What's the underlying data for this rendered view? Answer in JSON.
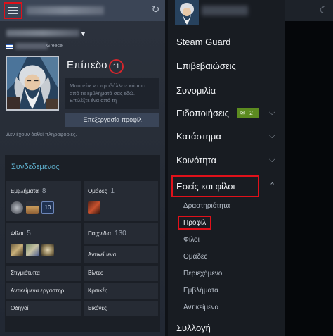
{
  "left": {
    "header": {
      "hamburger_icon": "hamburger-icon",
      "refresh_icon": "refresh-icon"
    },
    "profile": {
      "country": "Greece",
      "level_label": "Επίπεδο",
      "level": "11",
      "showcase_text": "Μπορείτε να προβάλλετε κάποιο από τα εμβλήματά σας εδώ. Επιλέξτε ένα από τη",
      "edit_button": "Επεξεργασία προφίλ",
      "no_info": "Δεν έχουν δοθεί πληροφορίες."
    },
    "status": "Συνδεδεμένος",
    "stats": {
      "badges": {
        "label": "Εμβλήματα",
        "count": "8"
      },
      "groups": {
        "label": "Ομάδες",
        "count": "1"
      },
      "friends": {
        "label": "Φίλοι",
        "count": "5"
      },
      "games": {
        "label": "Παιχνίδια",
        "count": "130"
      }
    },
    "links": {
      "inventory": "Αντικείμενα",
      "screenshots": "Στιγμιότυπα",
      "videos": "Βίντεο",
      "workshop": "Αντικείμενα εργαστηρ...",
      "reviews": "Κριτικές",
      "guides": "Οδηγοί",
      "artwork": "Εικόνες"
    }
  },
  "menu": {
    "items": [
      {
        "label": "Steam Guard"
      },
      {
        "label": "Επιβεβαιώσεις"
      },
      {
        "label": "Συνομιλία"
      },
      {
        "label": "Ειδοποιήσεις",
        "badge": "2"
      },
      {
        "label": "Κατάστημα"
      },
      {
        "label": "Κοινότητα"
      },
      {
        "label": "Εσείς και φίλοι"
      }
    ],
    "sub_items": [
      "Δραστηριότητα",
      "Προφίλ",
      "Φίλοι",
      "Ομάδες",
      "Περιεχόμενο",
      "Εμβλήματα",
      "Αντικείμενα"
    ],
    "last": "Συλλογή"
  },
  "colors": {
    "highlight": "#e0111a",
    "status": "#5eaecb",
    "badge": "#5c8b20"
  }
}
